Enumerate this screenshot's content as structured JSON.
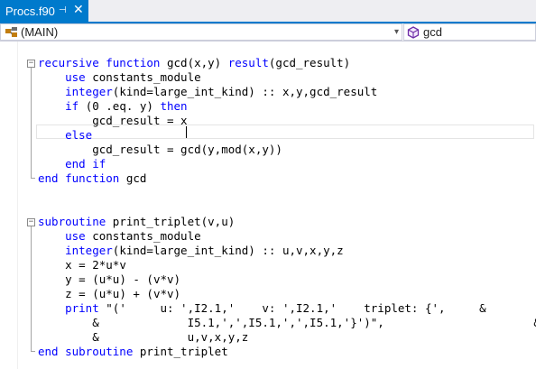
{
  "tab": {
    "title": "Procs.f90",
    "pin_glyph": "⊣",
    "close_glyph": "✕"
  },
  "navbar": {
    "scope_value": "(MAIN)",
    "member_value": "gcd",
    "arrow_glyph": "▾",
    "scope_icon": "program-icon",
    "member_icon": "function-cube-icon"
  },
  "colors": {
    "keyword": "#0000ff",
    "tab_active": "#007acc",
    "text": "#000000"
  },
  "code": [
    {
      "indent": "",
      "tokens": [
        {
          "t": "recursive function",
          "k": true
        },
        {
          "t": " gcd(x,y) ",
          "k": false
        },
        {
          "t": "result",
          "k": true
        },
        {
          "t": "(gcd_result)",
          "k": false
        }
      ]
    },
    {
      "indent": "    ",
      "tokens": [
        {
          "t": "use",
          "k": true
        },
        {
          "t": " constants_module",
          "k": false
        }
      ]
    },
    {
      "indent": "    ",
      "tokens": [
        {
          "t": "integer",
          "k": true
        },
        {
          "t": "(kind=large_int_kind) :: x,y,gcd_result",
          "k": false
        }
      ]
    },
    {
      "indent": "    ",
      "tokens": [
        {
          "t": "if",
          "k": true
        },
        {
          "t": " (0 .eq. y) ",
          "k": false
        },
        {
          "t": "then",
          "k": true
        }
      ]
    },
    {
      "indent": "        ",
      "tokens": [
        {
          "t": "gcd_result = x",
          "k": false
        }
      ]
    },
    {
      "indent": "    ",
      "tokens": [
        {
          "t": "else",
          "k": true
        }
      ]
    },
    {
      "indent": "        ",
      "tokens": [
        {
          "t": "gcd_result = gcd(y,mod(x,y))",
          "k": false
        }
      ]
    },
    {
      "indent": "    ",
      "tokens": [
        {
          "t": "end if",
          "k": true
        }
      ]
    },
    {
      "indent": "",
      "tokens": [
        {
          "t": "end function",
          "k": true
        },
        {
          "t": " gcd",
          "k": false
        }
      ]
    },
    {
      "indent": "",
      "tokens": []
    },
    {
      "indent": "",
      "tokens": []
    },
    {
      "indent": "",
      "tokens": [
        {
          "t": "subroutine",
          "k": true
        },
        {
          "t": " print_triplet(v,u)",
          "k": false
        }
      ]
    },
    {
      "indent": "    ",
      "tokens": [
        {
          "t": "use",
          "k": true
        },
        {
          "t": " constants_module",
          "k": false
        }
      ]
    },
    {
      "indent": "    ",
      "tokens": [
        {
          "t": "integer",
          "k": true
        },
        {
          "t": "(kind=large_int_kind) :: u,v,x,y,z",
          "k": false
        }
      ]
    },
    {
      "indent": "    ",
      "tokens": [
        {
          "t": "x = 2*u*v",
          "k": false
        }
      ]
    },
    {
      "indent": "    ",
      "tokens": [
        {
          "t": "y = (u*u) - (v*v)",
          "k": false
        }
      ]
    },
    {
      "indent": "    ",
      "tokens": [
        {
          "t": "z = (u*u) + (v*v)",
          "k": false
        }
      ]
    },
    {
      "indent": "    ",
      "tokens": [
        {
          "t": "print",
          "k": true
        },
        {
          "t": " \"('     u: ',I2.1,'    v: ',I2.1,'    triplet: {',     &",
          "k": false
        }
      ]
    },
    {
      "indent": "        ",
      "tokens": [
        {
          "t": "&             I5.1,',',I5.1,',',I5.1,'}')\",                      &",
          "k": false
        }
      ]
    },
    {
      "indent": "        ",
      "tokens": [
        {
          "t": "&             u,v,x,y,z",
          "k": false
        }
      ]
    },
    {
      "indent": "",
      "tokens": [
        {
          "t": "end subroutine",
          "k": true
        },
        {
          "t": " print_triplet",
          "k": false
        }
      ]
    }
  ]
}
